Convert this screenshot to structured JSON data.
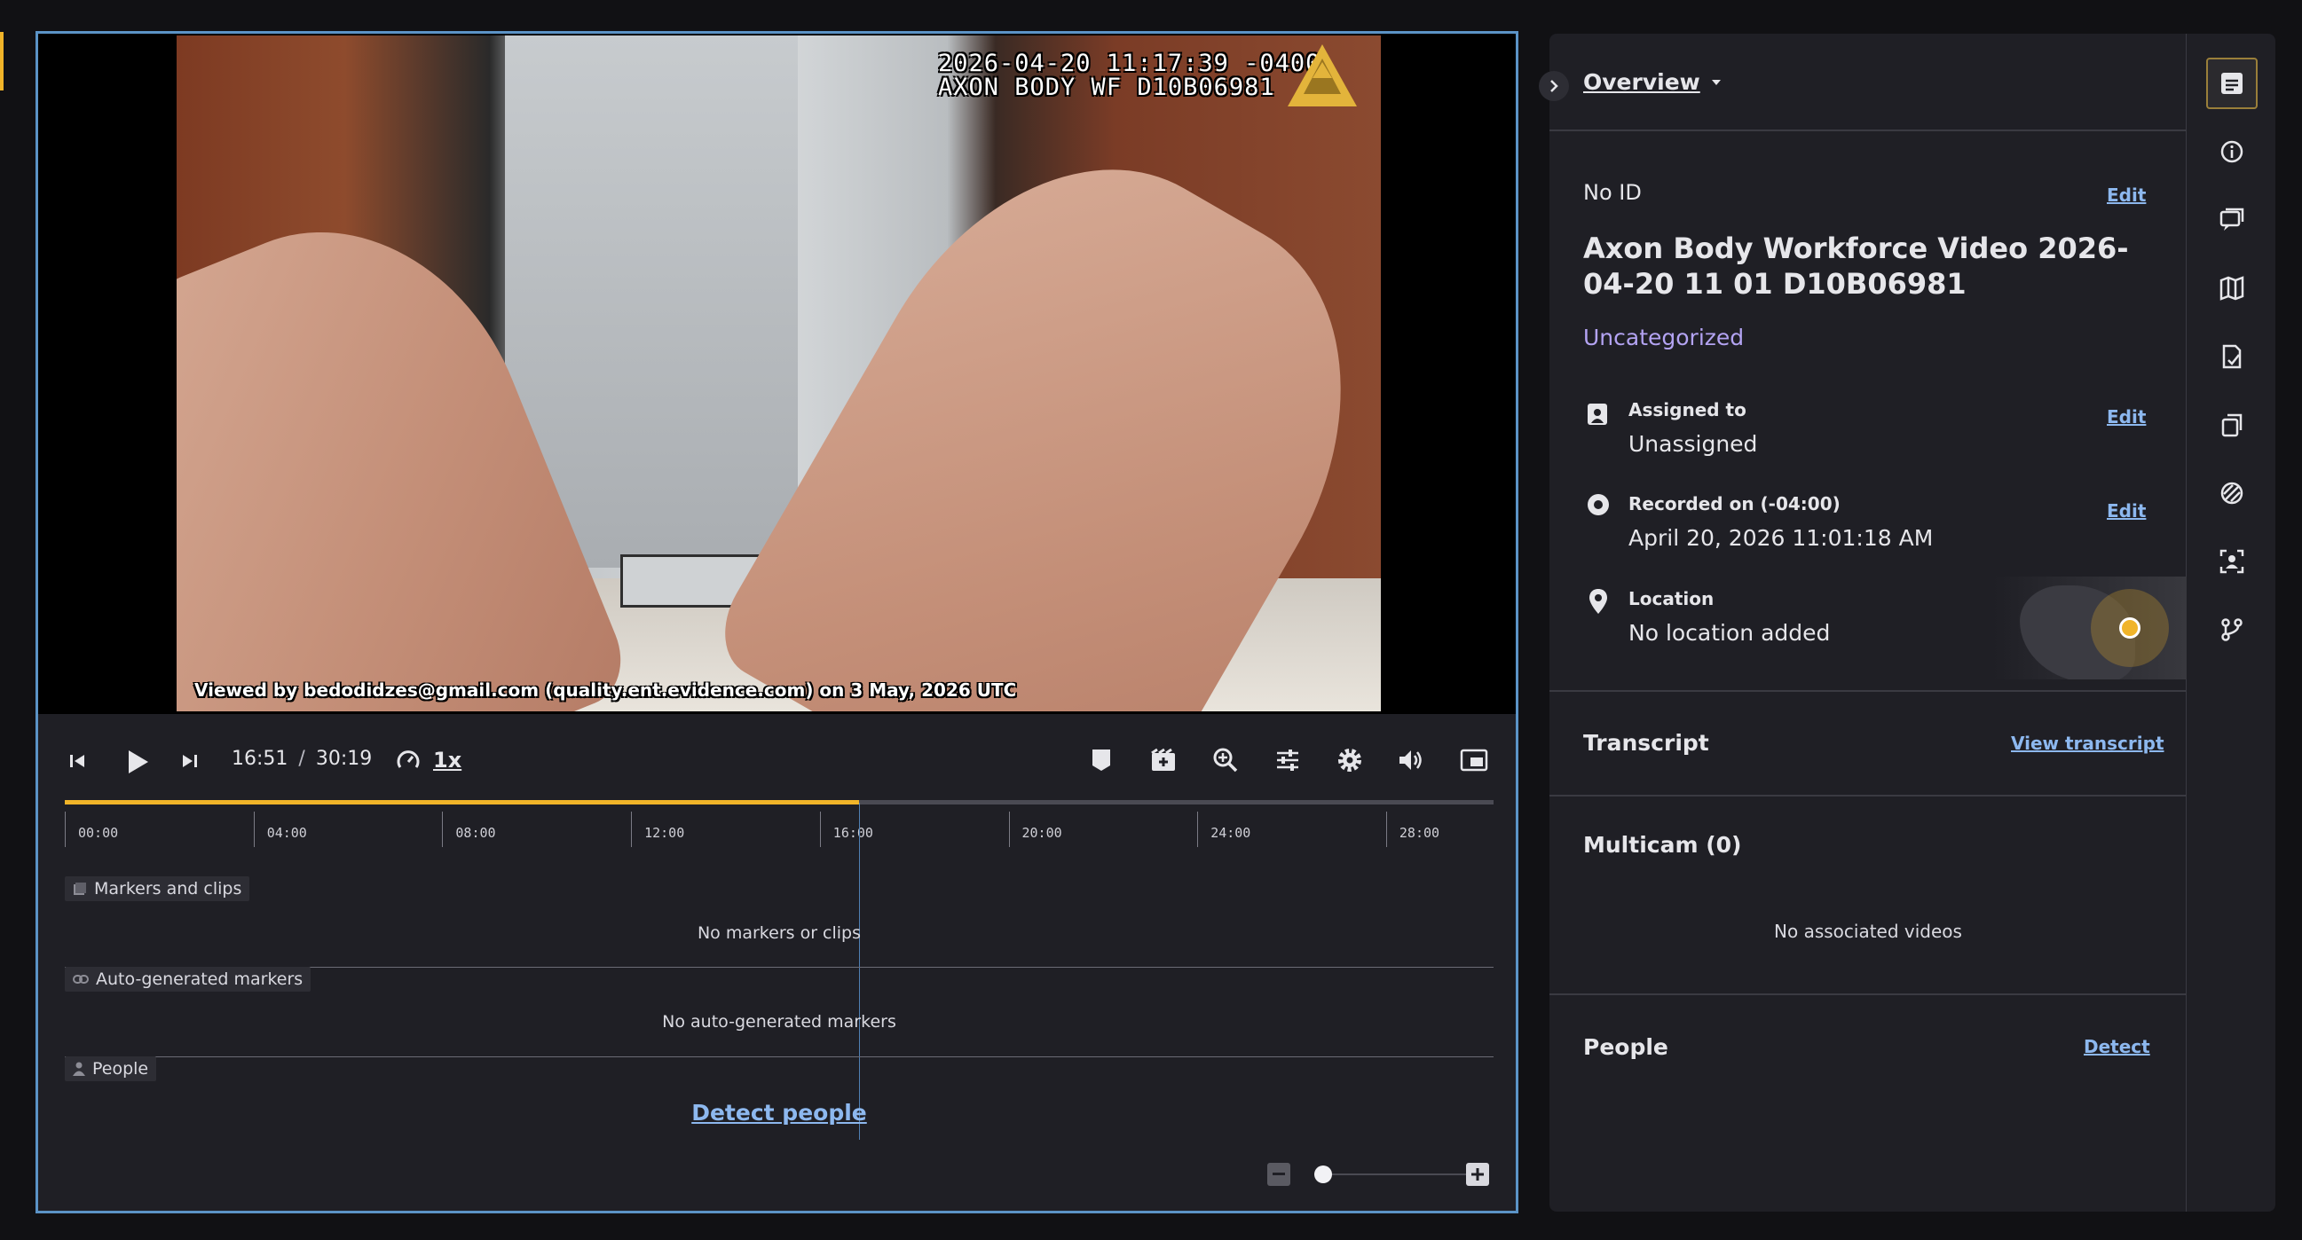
{
  "video": {
    "osd_timestamp": "2026-04-20 11:17:39 -0400",
    "osd_device": "AXON BODY WF  D10B06981",
    "watermark": "Viewed by bedodidzes@gmail.com (quality.ent.evidence.com) on 3 May, 2026 UTC"
  },
  "controls": {
    "current_time": "16:51",
    "separator": "/",
    "duration": "30:19",
    "speed": "1x",
    "progress_fraction": 0.556,
    "ticks": [
      "00:00",
      "04:00",
      "08:00",
      "12:00",
      "16:00",
      "20:00",
      "24:00",
      "28:00"
    ]
  },
  "timeline": {
    "markers_label": "Markers and clips",
    "markers_empty": "No markers or clips",
    "auto_label": "Auto-generated markers",
    "auto_empty": "No auto-generated markers",
    "people_label": "People",
    "detect_people": "Detect people",
    "zoom_fraction": 0.0
  },
  "panel": {
    "overview_label": "Overview",
    "id_label": "No ID",
    "edit": "Edit",
    "title": "Axon Body Workforce Video 2026-04-20 11 01 D10B06981",
    "category": "Uncategorized",
    "assigned_label": "Assigned to",
    "assigned_value": "Unassigned",
    "recorded_label": "Recorded on (-04:00)",
    "recorded_value": "April 20, 2026 11:01:18 AM",
    "location_label": "Location",
    "location_value": "No location added",
    "transcript_label": "Transcript",
    "view_transcript": "View transcript",
    "multicam_label": "Multicam (0)",
    "multicam_empty": "No associated videos",
    "people_label": "People",
    "detect": "Detect"
  },
  "colors": {
    "accent": "#f0b429",
    "link": "#8db8ef",
    "border": "#5b93c6"
  },
  "rail_icons": [
    "overview-icon",
    "info-icon",
    "comments-icon",
    "map-icon",
    "audit-icon",
    "copies-icon",
    "redaction-icon",
    "face-detect-icon",
    "branch-icon"
  ]
}
